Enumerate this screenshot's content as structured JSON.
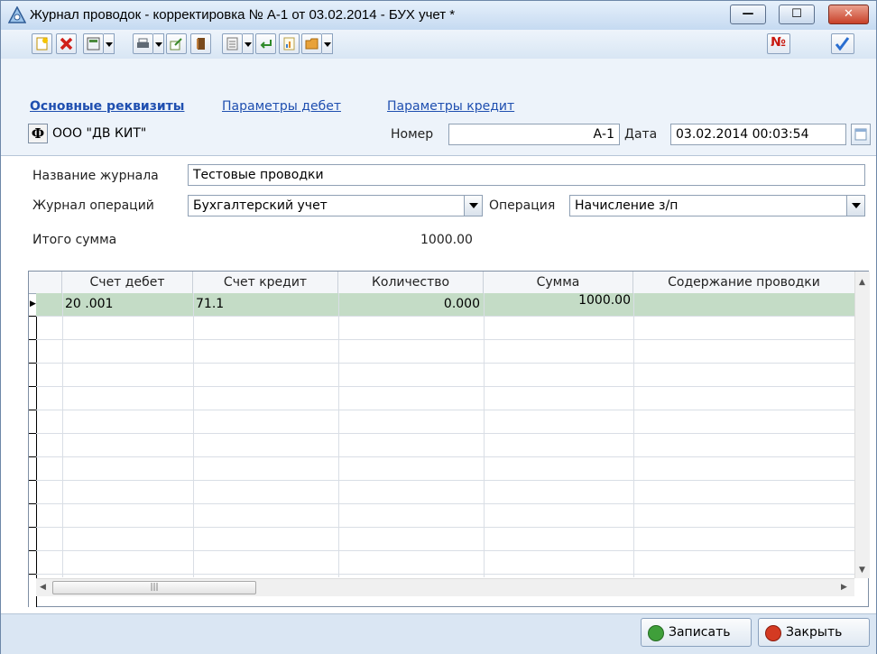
{
  "window": {
    "title": "Журнал проводок - корректировка № А-1 от 03.02.2014 - БУХ учет *",
    "accent": "#c8412a"
  },
  "toolbar": {
    "items": [
      "new-doc-icon",
      "delete-icon",
      "calculator-icon",
      "print-icon",
      "export-icon",
      "book-icon",
      "list-icon",
      "enter-icon",
      "report-icon",
      "folder-icon"
    ],
    "number_badge": "№",
    "confirm_icon": "checkmark-icon"
  },
  "tabs": {
    "main": "Основные реквизиты",
    "debit": "Параметры дебет",
    "credit": "Параметры кредит"
  },
  "header": {
    "org_button": "Ф",
    "org_name": "ООО \"ДВ КИТ\"",
    "number_label": "Номер",
    "number_value": "А-1",
    "date_label": "Дата",
    "date_value": "03.02.2014 00:03:54"
  },
  "fields": {
    "journal_name_label": "Название журнала",
    "journal_name_value": "Тестовые проводки",
    "ops_journal_label": "Журнал операций",
    "ops_journal_value": "Бухгалтерский учет",
    "operation_label": "Операция",
    "operation_value": "Начисление з/п",
    "total_label": "Итого сумма",
    "total_value": "1000.00"
  },
  "grid": {
    "columns": [
      "Счет дебет",
      "Счет кредит",
      "Количество",
      "Сумма",
      "Содержание проводки"
    ],
    "rows": [
      {
        "debit": "20 .001",
        "credit": "71.1",
        "qty": "0.000",
        "sum": "1000.00",
        "desc": ""
      }
    ],
    "selected_color": "#c4dcc6"
  },
  "buttons": {
    "save": "Записать",
    "close": "Закрыть"
  }
}
